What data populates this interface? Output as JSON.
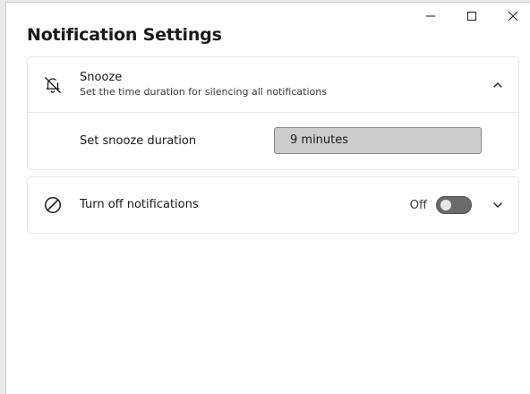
{
  "window": {
    "title": "Notification Settings"
  },
  "snooze": {
    "title": "Snooze",
    "description": "Set the time duration for silencing all notifications",
    "duration_label": "Set snooze duration",
    "duration_value": "9 minutes",
    "expanded": true
  },
  "turn_off": {
    "title": "Turn off notifications",
    "toggle_state_label": "Off",
    "toggle_on": false,
    "expanded": false
  },
  "icons": {
    "minimize": "minimize-icon",
    "maximize": "maximize-icon",
    "close": "close-icon",
    "snooze": "bell-off-icon",
    "turn_off": "prohibited-icon",
    "collapse": "chevron-up-icon",
    "expand": "chevron-down-icon"
  },
  "colors": {
    "toggle_off_track": "#6b6b6b",
    "field_background": "#cccccc"
  }
}
